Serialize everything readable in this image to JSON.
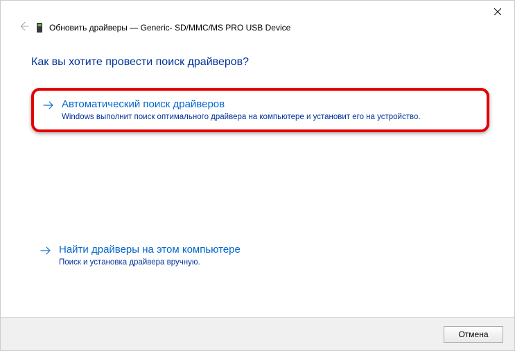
{
  "window": {
    "title": "Обновить драйверы — Generic- SD/MMC/MS PRO USB Device"
  },
  "main": {
    "question": "Как вы хотите провести поиск драйверов?",
    "options": [
      {
        "title": "Автоматический поиск драйверов",
        "description": "Windows выполнит поиск оптимального драйвера на компьютере и установит его на устройство."
      },
      {
        "title": "Найти драйверы на этом компьютере",
        "description": "Поиск и установка драйвера вручную."
      }
    ]
  },
  "footer": {
    "cancel_label": "Отмена"
  }
}
